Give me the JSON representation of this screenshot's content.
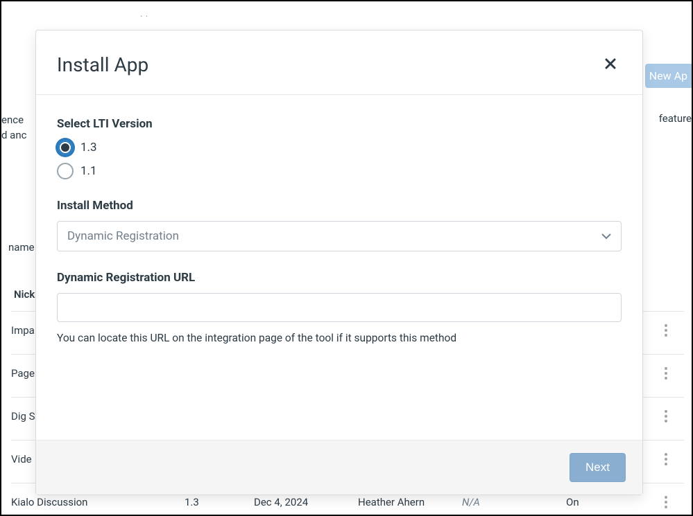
{
  "background": {
    "new_app_button": "New Ap",
    "desc_line1": "ence",
    "desc_line2": "d anc",
    "desc_right": "feature",
    "name_label": "name",
    "nick_label": "Nick",
    "rows": [
      {
        "name": "Impa",
        "ver": "",
        "date": "",
        "who": "",
        "na": "",
        "on": ""
      },
      {
        "name": "Page",
        "ver": "",
        "date": "",
        "who": "",
        "na": "",
        "on": ""
      },
      {
        "name": "Dig S",
        "ver": "",
        "date": "",
        "who": "",
        "na": "",
        "on": ""
      },
      {
        "name": "Vide",
        "ver": "",
        "date": "",
        "who": "",
        "na": "",
        "on": ""
      },
      {
        "name": "Kialo Discussion",
        "ver": "1.3",
        "date": "Dec 4, 2024",
        "who": "Heather Ahern",
        "na": "N/A",
        "on": "On"
      }
    ]
  },
  "modal": {
    "title": "Install App",
    "lti_label": "Select LTI Version",
    "radio_13": "1.3",
    "radio_11": "1.1",
    "install_method_label": "Install Method",
    "install_method_value": "Dynamic Registration",
    "url_label": "Dynamic Registration URL",
    "url_help": "You can locate this URL on the integration page of the tool if it supports this method",
    "next_label": "Next"
  }
}
